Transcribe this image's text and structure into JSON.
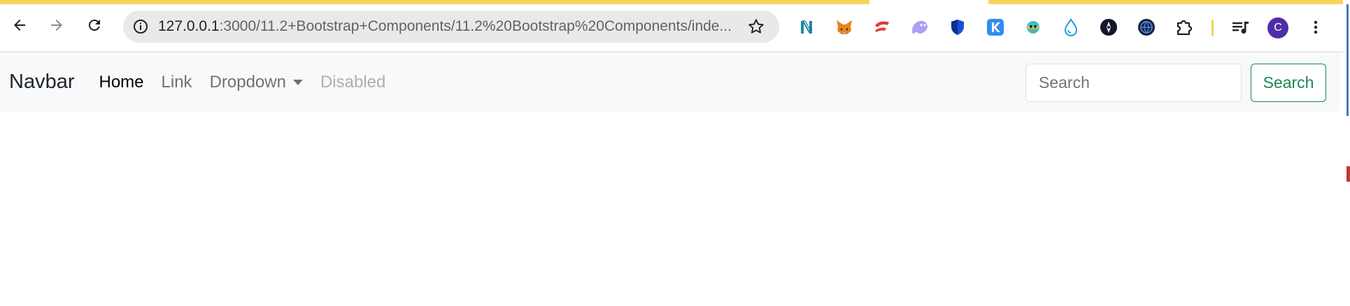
{
  "browser": {
    "url_host": "127.0.0.1",
    "url_rest": ":3000/11.2+Bootstrap+Components/11.2%20Bootstrap%20Components/inde...",
    "profile_initial": "C",
    "accent": "#f7d55c",
    "extensions": [
      "notion-icon",
      "metamask-fox-icon",
      "red-extension-icon",
      "ghost-icon",
      "shield-icon",
      "k-icon",
      "bird-icon",
      "droplet-icon",
      "compass-icon",
      "dark-globe-icon",
      "puzzle-icon"
    ]
  },
  "navbar": {
    "brand": "Navbar",
    "links": [
      {
        "label": "Home",
        "state": "active"
      },
      {
        "label": "Link",
        "state": "normal"
      },
      {
        "label": "Dropdown",
        "state": "dropdown"
      },
      {
        "label": "Disabled",
        "state": "disabled"
      }
    ],
    "search": {
      "placeholder": "Search",
      "button_label": "Search",
      "button_color": "#198754"
    }
  }
}
